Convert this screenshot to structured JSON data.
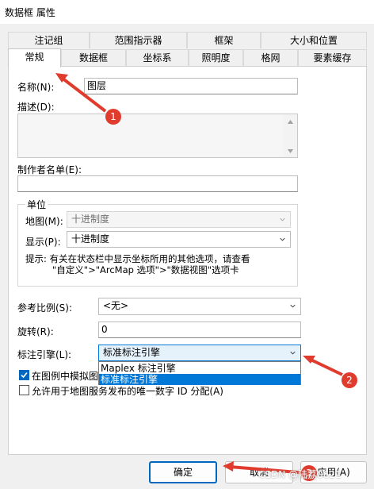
{
  "window": {
    "title": "数据框 属性"
  },
  "tabs_row1": [
    "注记组",
    "范围指示器",
    "框架",
    "大小和位置"
  ],
  "tabs_row2": [
    "常规",
    "数据框",
    "坐标系",
    "照明度",
    "格网",
    "要素缓存"
  ],
  "general": {
    "name_label": "名称(N):",
    "name_value": "图层",
    "desc_label": "描述(D):",
    "desc_value": "",
    "author_label": "制作者名单(E):",
    "author_value": "",
    "units": {
      "group_label": "单位",
      "map_label": "地图(M):",
      "map_value": "十进制度",
      "display_label": "显示(P):",
      "display_value": "十进制度",
      "tip_line1": "提示: 有关在状态栏中显示坐标所用的其他选项，请查看",
      "tip_line2": "\"自定义\">\"ArcMap 选项\">\"数据视图\"选项卡"
    },
    "scale_label": "参考比例(S):",
    "scale_value": "<无>",
    "rotation_label": "旋转(R):",
    "rotation_value": "0",
    "engine_label": "标注引擎(L):",
    "engine_value": "标准标注引擎",
    "engine_options": [
      "Maplex 标注引擎",
      "标准标注引擎"
    ],
    "check1_label": "在图例中模拟图",
    "check1_checked": true,
    "check2_label": "允许用于地图服务发布的唯一数字 ID 分配(A)",
    "check2_checked": false
  },
  "buttons": {
    "ok": "确定",
    "cancel": "取消",
    "apply": "应用(A)"
  },
  "annotations": [
    "1",
    "2",
    "3"
  ],
  "watermark": "CSDN @陆荔0621",
  "colors": {
    "accent": "#0067c0",
    "annotation": "#e03c2e",
    "selection": "#0078d7"
  }
}
